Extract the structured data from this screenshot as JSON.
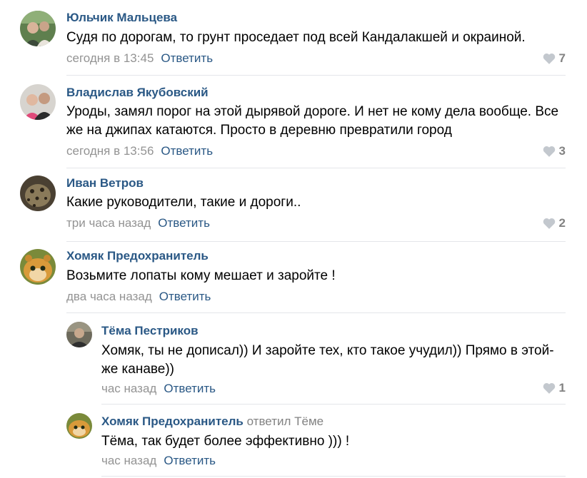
{
  "colors": {
    "link": "#2a5885",
    "meta": "#939393",
    "like": "#c3c8ce",
    "divider": "#e4e6ea"
  },
  "comments": [
    {
      "author": "Юльчик Мальцева",
      "text": "Судя по дорогам, то грунт проседает под всей Кандалакшей и окраиной.",
      "date": "сегодня в 13:45",
      "reply_label": "Ответить",
      "likes": "7",
      "like_icon": "heart-icon"
    },
    {
      "author": "Владислав Якубовский",
      "text": "Уроды, замял порог на этой дырявой дороге. И нет не кому дела вообще. Все же на джипах катаются. Просто в деревню превратили город",
      "date": "сегодня в 13:56",
      "reply_label": "Ответить",
      "likes": "3",
      "like_icon": "heart-icon"
    },
    {
      "author": "Иван Ветров",
      "text": "Какие руководители, такие и дороги..",
      "date": "три часа назад",
      "reply_label": "Ответить",
      "likes": "2",
      "like_icon": "heart-icon"
    },
    {
      "author": "Хомяк Предохранитель",
      "text": "Возьмите лопаты кому мешает и заройте !",
      "date": "два часа назад",
      "reply_label": "Ответить"
    },
    {
      "author": "Тёма Пестриков",
      "text": "Хомяк, ты не дописал)) И заройте тех, кто такое учудил)) Прямо в этой-же канаве))",
      "date": "час назад",
      "reply_label": "Ответить",
      "likes": "1",
      "like_icon": "heart-icon"
    },
    {
      "author": "Хомяк Предохранитель",
      "reply_to": "ответил Тёме",
      "text": "Тёма, так будет более эффективно ))) !",
      "date": "час назад",
      "reply_label": "Ответить"
    }
  ]
}
